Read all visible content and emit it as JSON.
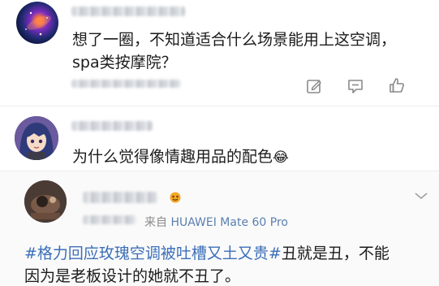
{
  "comment1": {
    "text_line1": "想了一圈，不知道适合什么场景能用上这空调，",
    "text_line2": "spa类按摩院？"
  },
  "comment2": {
    "text": "为什么觉得像情趣用品的配色",
    "emoji": "😂"
  },
  "post": {
    "source_prefix": "来自",
    "source_device": "HUAWEI Mate 60 Pro",
    "hashtag": "#格力回应玫瑰空调被吐槽又土又贵#",
    "text_after_hashtag": "丑就是丑，不能",
    "text_line2": "因为是老板设计的她就不丑了。"
  },
  "icons": {
    "edit": "edit-icon",
    "comment": "comment-icon",
    "like": "thumbs-up-icon",
    "chevron": "chevron-down-icon"
  }
}
